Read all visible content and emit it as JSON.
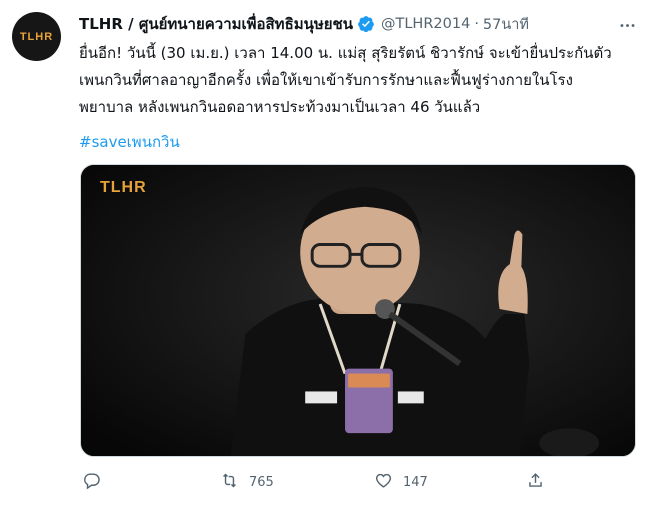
{
  "tweet": {
    "avatar_text": "TLHR",
    "display_name": "TLHR / ศูนย์ทนายความเพื่อสิทธิมนุษยชน",
    "handle": "@TLHR2014",
    "separator": "·",
    "time": "57นาที",
    "text_lines": [
      "ยื่นอีก! วันนี้ (30 เม.ย.) เวลา 14.00 น. แม่สุ สุริยรัตน์ ชิวารักษ์ จะเข้ายื่นประกันตัว",
      "เพนกวินที่ศาลอาญาอีกครั้ง เพื่อให้เขาเข้ารับการรักษาและฟื้นฟูร่างกายในโรง",
      "พยาบาล หลังเพนกวินอดอาหารประท้วงมาเป็นเวลา 46 วันแล้ว"
    ],
    "hashtag": "#saveเพนกวิน",
    "media_logo": "TLHR",
    "icons": {
      "verified": "verified-badge-icon",
      "more": "more-options-icon",
      "reply": "reply-icon",
      "retweet": "retweet-icon",
      "like": "like-icon",
      "share": "share-icon"
    },
    "colors": {
      "accent": "#1d9bf0",
      "secondary_text": "#536471",
      "logo_orange": "#e8a23a"
    },
    "actions": {
      "reply_count": "",
      "retweet_count": "765",
      "like_count": "147"
    }
  }
}
